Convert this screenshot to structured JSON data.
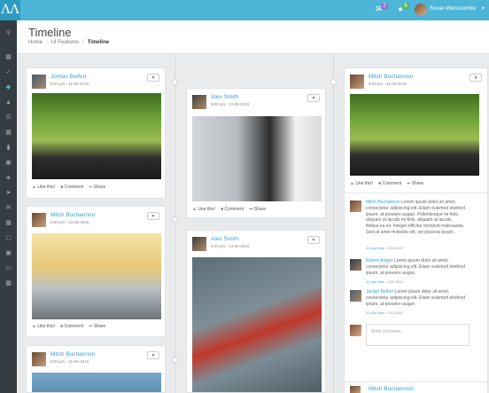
{
  "app": {
    "brand": "ΛΛ"
  },
  "topbar": {
    "mail_badge": "2",
    "notif_badge": "6",
    "user_name": "Susan Wenscombe"
  },
  "header": {
    "title": "Timeline",
    "breadcrumb": [
      "Home",
      "UI Features",
      "Timeline"
    ]
  },
  "sidebar": {
    "icons": [
      "search-icon",
      "grid-icon",
      "bolt-icon",
      "diamond-icon",
      "flask-icon",
      "list-icon",
      "table-icon",
      "chart-icon",
      "map-icon",
      "layers-icon",
      "send-icon",
      "mail-icon",
      "calendar-icon",
      "file-icon",
      "image-icon",
      "monitor-icon",
      "sitemap-icon"
    ],
    "active_index": 3
  },
  "actions": {
    "like": "Like this!",
    "comment": "Comment",
    "share": "Share"
  },
  "col1": [
    {
      "name": "Jordan Belfort",
      "time": "9:00 pm - 11-06-2016"
    },
    {
      "name": "Mitch Buchannon",
      "time": "9:00 pm - 13-06-2016"
    },
    {
      "name": "Mitch Buchannon",
      "time": "9:00 pm - 15-06-2016"
    }
  ],
  "col2": [
    {
      "name": "Alex Smith",
      "time": "9:00 pm - 12-06-2016"
    },
    {
      "name": "Alex Smith",
      "time": "9:00 pm - 14-06-2016"
    }
  ],
  "col3": {
    "post": {
      "name": "Mitch Buchannon",
      "time": "9:00 pm - 11-06-2016"
    },
    "comments": [
      {
        "name": "Mitch Buchannon",
        "text": "Lorem ipsum dolor sit amet, consectetur adipiscing elit. Etiam euismod eleifend ipsum, at posuere augue. Pellentesque mi felis, aliquam at iaculis mi felis, aliquam at iaculis finibus eu ex. Integer efficitur tincidunt malesuada. Sed sit amet molestie elit, vel placerat ipsum.",
        "likes": "11 Like this!",
        "date": "2.01.2017"
      },
      {
        "name": "Robert Angier",
        "text": "Lorem ipsum dolor sit amet, consectetur adipiscing elit. Etiam euismod eleifend ipsum, at posuere augue.",
        "likes": "11 Like this!",
        "date": "2.01.2017"
      },
      {
        "name": "Jordan Belfort",
        "text": "Lorem ipsum dolor sit amet, consectetur adipiscing elit. Etiam euismod eleifend ipsum, at posuere augue.",
        "likes": "11 Like this!",
        "date": "2.01.2017"
      }
    ],
    "write_placeholder": "Write comment...",
    "bottom_name": "Mitch Buchannon"
  }
}
